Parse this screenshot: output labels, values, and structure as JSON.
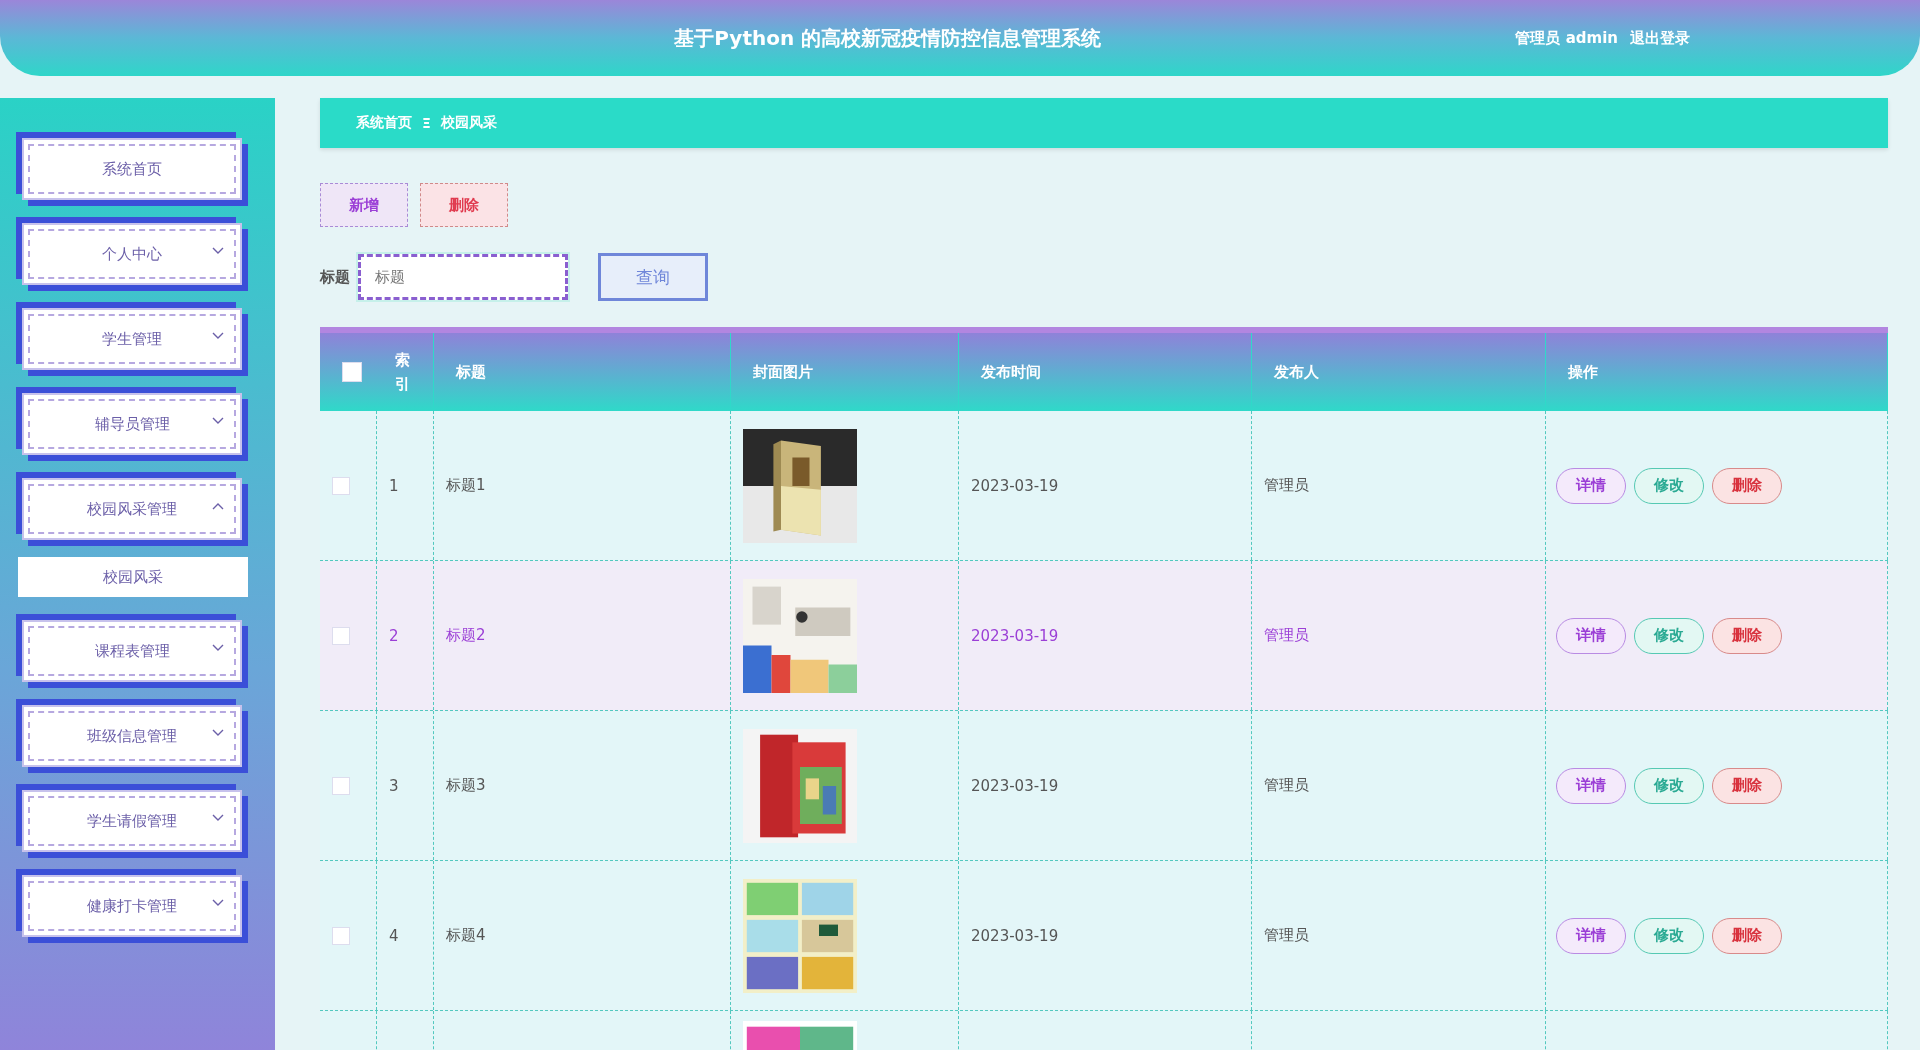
{
  "header": {
    "title": "基于Python 的高校新冠疫情防控信息管理系统",
    "user": "管理员 admin",
    "logout": "退出登录"
  },
  "sidebar": {
    "items": [
      {
        "label": "系统首页",
        "kind": "link"
      },
      {
        "label": "个人中心",
        "kind": "group",
        "expanded": false
      },
      {
        "label": "学生管理",
        "kind": "group",
        "expanded": false
      },
      {
        "label": "辅导员管理",
        "kind": "group",
        "expanded": false
      },
      {
        "label": "校园风采管理",
        "kind": "group",
        "expanded": true,
        "children": [
          {
            "label": "校园风采",
            "selected": true
          }
        ]
      },
      {
        "label": "课程表管理",
        "kind": "group",
        "expanded": false
      },
      {
        "label": "班级信息管理",
        "kind": "group",
        "expanded": false
      },
      {
        "label": "学生请假管理",
        "kind": "group",
        "expanded": false
      },
      {
        "label": "健康打卡管理",
        "kind": "group",
        "expanded": false
      }
    ]
  },
  "breadcrumb": {
    "home": "系统首页",
    "separator": "Ξ",
    "current": "校园风采"
  },
  "toolbar": {
    "add": "新增",
    "delete": "删除"
  },
  "search": {
    "label": "标题",
    "placeholder": "标题",
    "button": "查询"
  },
  "table": {
    "all_checked": false,
    "columns": [
      "索引",
      "标题",
      "封面图片",
      "发布时间",
      "发布人",
      "操作"
    ],
    "rows": [
      {
        "checked": false,
        "highlighted": false,
        "index": "1",
        "title": "标题1",
        "cover": {
          "kind": "picture"
        },
        "time": "2023-03-19",
        "publisher": "管理员",
        "actions": [
          "详情",
          "修改",
          "删除"
        ]
      },
      {
        "checked": false,
        "highlighted": true,
        "index": "2",
        "title": "标题2",
        "cover": {
          "kind": "picture"
        },
        "time": "2023-03-19",
        "publisher": "管理员",
        "actions": [
          "详情",
          "修改",
          "删除"
        ]
      },
      {
        "checked": false,
        "highlighted": false,
        "index": "3",
        "title": "标题3",
        "cover": {
          "kind": "picture"
        },
        "time": "2023-03-19",
        "publisher": "管理员",
        "actions": [
          "详情",
          "修改",
          "删除"
        ]
      },
      {
        "checked": false,
        "highlighted": false,
        "index": "4",
        "title": "标题4",
        "cover": {
          "kind": "picture"
        },
        "time": "2023-03-19",
        "publisher": "管理员",
        "actions": [
          "详情",
          "修改",
          "删除"
        ]
      },
      {
        "cover": {
          "kind": "picture"
        }
      }
    ]
  }
}
